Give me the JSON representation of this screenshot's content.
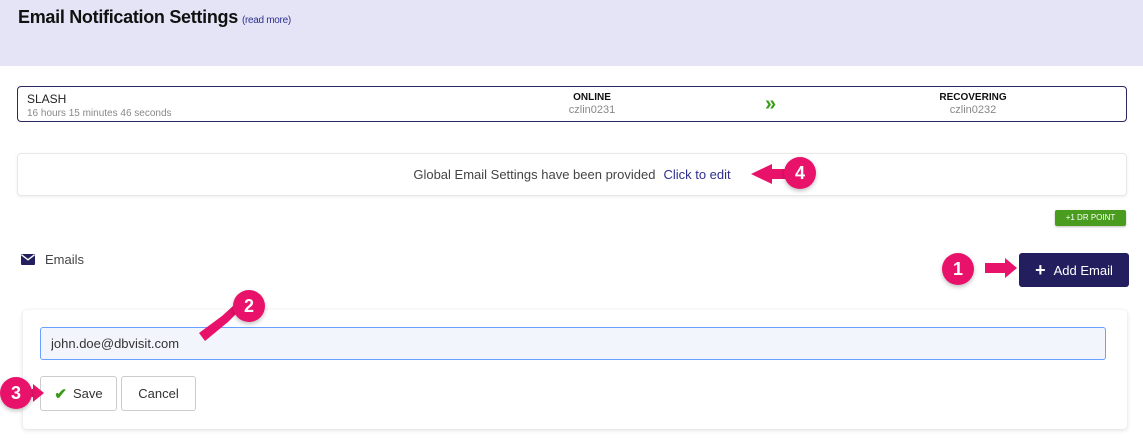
{
  "header": {
    "title": "Email Notification Settings",
    "read_more": "(read more)"
  },
  "status": {
    "name": "SLASH",
    "duration": "16 hours 15 minutes 46 seconds",
    "primary": {
      "state": "ONLINE",
      "host": "czlin0231"
    },
    "arrow": "»",
    "standby": {
      "state": "RECOVERING",
      "host": "czlin0232"
    }
  },
  "global_email": {
    "message": "Global Email Settings have been provided",
    "edit_link": "Click to edit"
  },
  "badge": {
    "label": "+1 DR POINT"
  },
  "emails": {
    "label": "Emails",
    "icon": "envelope-icon"
  },
  "add_email": {
    "label": "Add Email",
    "icon": "plus-icon"
  },
  "form": {
    "email_value": "john.doe@dbvisit.com",
    "save_label": "Save",
    "cancel_label": "Cancel"
  },
  "callouts": {
    "one": "1",
    "two": "2",
    "three": "3",
    "four": "4"
  },
  "colors": {
    "header_bg": "#e4e4f6",
    "primary_btn": "#231f5f",
    "badge": "#4a9c1e",
    "callout": "#e8126b",
    "success": "#3a9a1a"
  }
}
